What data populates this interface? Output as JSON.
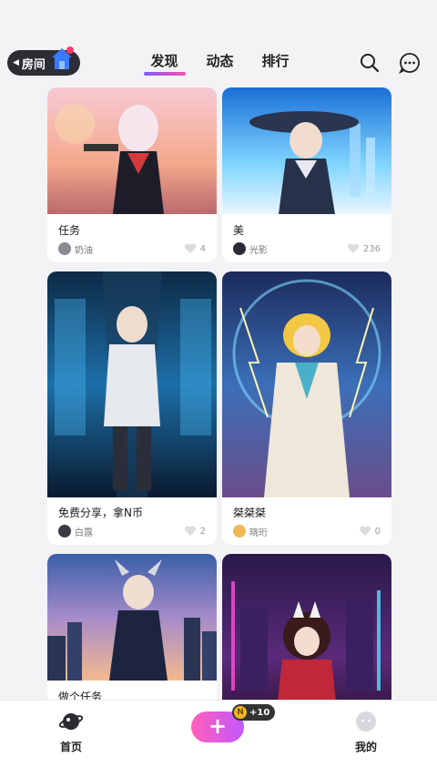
{
  "header": {
    "room_label": "房间",
    "tabs": [
      {
        "label": "发现",
        "active": true
      },
      {
        "label": "动态",
        "active": false
      },
      {
        "label": "排行",
        "active": false
      }
    ]
  },
  "feed": {
    "cards": [
      {
        "title": "任务",
        "author": "奶油",
        "likes": "4",
        "image": "anime-girl-with-pistol"
      },
      {
        "title": "美",
        "author": "光影",
        "likes": "236",
        "image": "anime-boy-wide-hat-city"
      },
      {
        "title": "免费分享，拿N币",
        "author": "白露",
        "likes": "2",
        "image": "anime-boy-sci-fi-corridor"
      },
      {
        "title": "桀桀桀",
        "author": "晓珩",
        "likes": "0",
        "image": "anime-blonde-mage-lightning"
      },
      {
        "title": "做个任务",
        "author": "",
        "likes": "",
        "image": "anime-boy-horns-city-sunset"
      },
      {
        "title": "",
        "author": "",
        "likes": "",
        "image": "anime-girl-fox-mask-neon"
      }
    ]
  },
  "bottom_nav": {
    "home_label": "首页",
    "me_label": "我的",
    "create_symbol": "+",
    "coin_reward": "+10",
    "coin_letter": "N"
  },
  "colors": {
    "accent_gradient_start": "#ff5fb8",
    "accent_gradient_end": "#c357ff",
    "tab_underline": "#7b5cff"
  }
}
